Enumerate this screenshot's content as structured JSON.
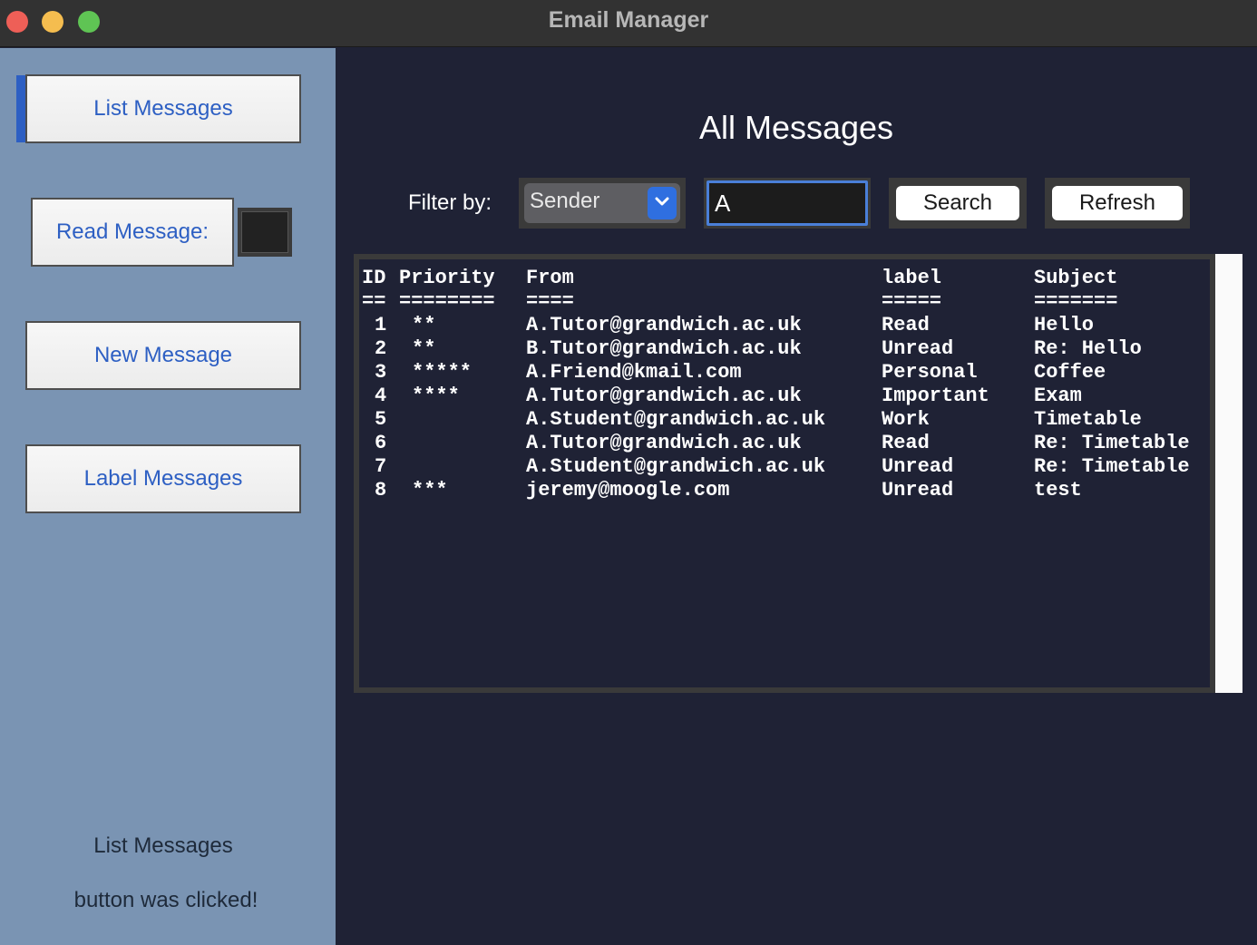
{
  "window": {
    "title": "Email Manager"
  },
  "sidebar": {
    "list_button": "List Messages",
    "read_button": "Read Message:",
    "new_button": "New Message",
    "label_button": "Label Messages",
    "status_line1": "List Messages",
    "status_line2": "button was clicked!"
  },
  "main": {
    "heading": "All Messages",
    "filter_label": "Filter by:",
    "filter_selected": "Sender",
    "search_value": "A",
    "search_button": "Search",
    "refresh_button": "Refresh"
  },
  "table": {
    "headers": [
      "ID",
      "Priority",
      "From",
      "label",
      "Subject"
    ],
    "underlines": [
      "==",
      "========",
      "====",
      "=====",
      "======="
    ],
    "rows": [
      {
        "id": "1",
        "priority": "**",
        "from": "A.Tutor@grandwich.ac.uk",
        "label": "Read",
        "subject": "Hello"
      },
      {
        "id": "2",
        "priority": "**",
        "from": "B.Tutor@grandwich.ac.uk",
        "label": "Unread",
        "subject": "Re: Hello"
      },
      {
        "id": "3",
        "priority": "*****",
        "from": "A.Friend@kmail.com",
        "label": "Personal",
        "subject": "Coffee"
      },
      {
        "id": "4",
        "priority": "****",
        "from": "A.Tutor@grandwich.ac.uk",
        "label": "Important",
        "subject": "Exam"
      },
      {
        "id": "5",
        "priority": "",
        "from": "A.Student@grandwich.ac.uk",
        "label": "Work",
        "subject": "Timetable"
      },
      {
        "id": "6",
        "priority": "",
        "from": "A.Tutor@grandwich.ac.uk",
        "label": "Read",
        "subject": "Re: Timetable"
      },
      {
        "id": "7",
        "priority": "",
        "from": "A.Student@grandwich.ac.uk",
        "label": "Unread",
        "subject": "Re: Timetable"
      },
      {
        "id": "8",
        "priority": "***",
        "from": "jeremy@moogle.com",
        "label": "Unread",
        "subject": "test"
      }
    ]
  }
}
